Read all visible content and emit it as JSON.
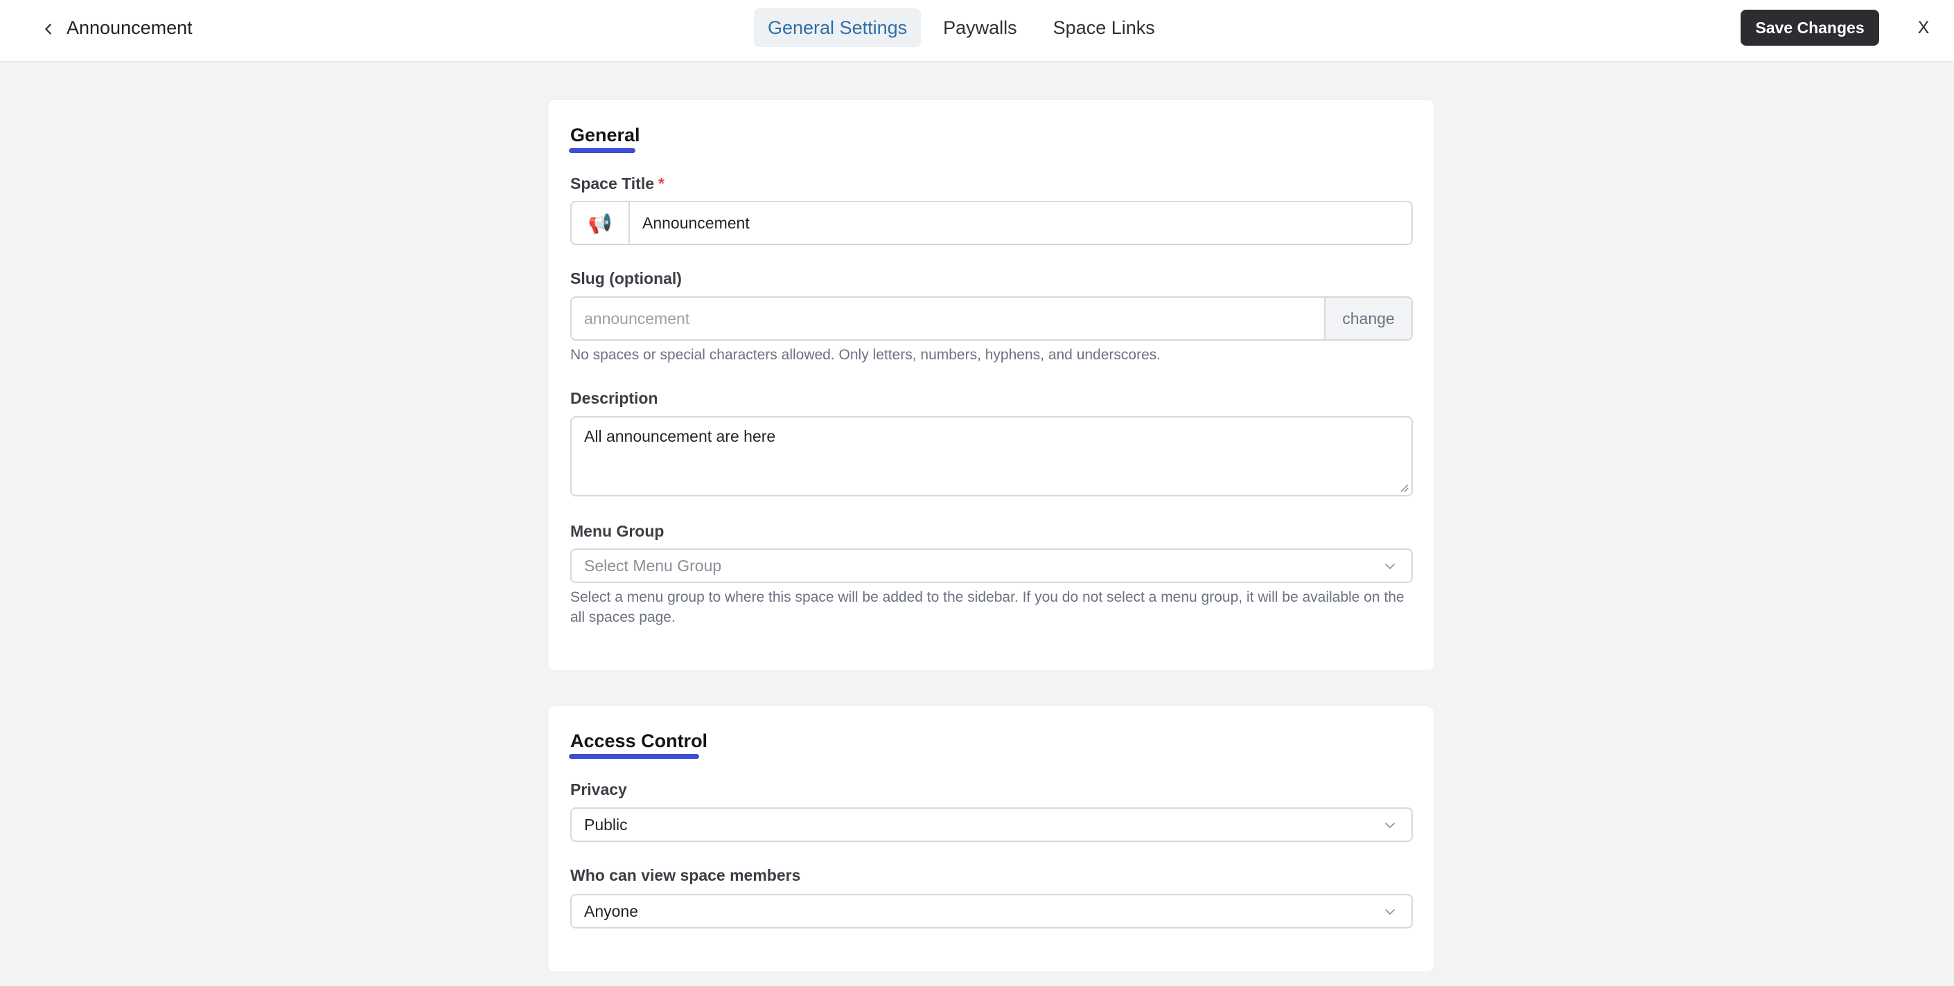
{
  "header": {
    "title": "Announcement",
    "tabs": [
      {
        "label": "General Settings",
        "active": true
      },
      {
        "label": "Paywalls",
        "active": false
      },
      {
        "label": "Space Links",
        "active": false
      }
    ],
    "save_label": "Save Changes",
    "close_label": "X"
  },
  "general": {
    "section_title": "General",
    "space_title": {
      "label": "Space Title",
      "required_mark": "*",
      "emoji": "📢",
      "value": "Announcement"
    },
    "slug": {
      "label": "Slug (optional)",
      "placeholder": "announcement",
      "change_label": "change",
      "help": "No spaces or special characters allowed. Only letters, numbers, hyphens, and underscores."
    },
    "description": {
      "label": "Description",
      "value": "All announcement are here"
    },
    "menu_group": {
      "label": "Menu Group",
      "placeholder": "Select Menu Group",
      "help": "Select a menu group to where this space will be added to the sidebar. If you do not select a menu group, it will be available on the all spaces page."
    }
  },
  "access": {
    "section_title": "Access Control",
    "privacy": {
      "label": "Privacy",
      "value": "Public"
    },
    "members_view": {
      "label": "Who can view space members",
      "value": "Anyone"
    }
  },
  "colors": {
    "accent_underline": "#3d4fd6",
    "active_tab_text": "#2f6ea6",
    "save_button_bg": "#2b2d31"
  }
}
